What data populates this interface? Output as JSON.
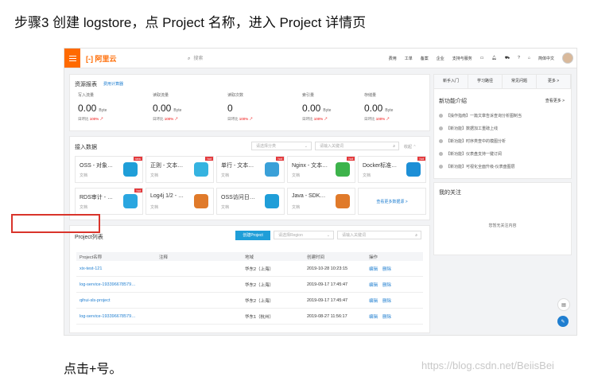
{
  "step_title": "步骤3   创建 logstore，点 Project 名称，进入 Project 详情页",
  "footer_text": "点击+号。",
  "watermark": "https://blog.csdn.net/BeiisBei",
  "topbar": {
    "logo": "[-] 阿里云",
    "search_placeholder": "搜索",
    "nav": [
      "费用",
      "工单",
      "备案",
      "企业",
      "支持与服务"
    ],
    "lang": "简体中文"
  },
  "overview": {
    "title": "资源报表",
    "link": "费用计算器",
    "metrics": [
      {
        "label": "写入流量",
        "value": "0.00",
        "unit": "Byte",
        "cmp_label": "日环比",
        "cmp": "100%"
      },
      {
        "label": "读取流量",
        "value": "0.00",
        "unit": "Byte",
        "cmp_label": "日环比",
        "cmp": "100%"
      },
      {
        "label": "读取次数",
        "value": "0",
        "unit": "",
        "cmp_label": "日环比",
        "cmp": "100%"
      },
      {
        "label": "索引量",
        "value": "0.00",
        "unit": "Byte",
        "cmp_label": "日环比",
        "cmp": "100%"
      },
      {
        "label": "存储量",
        "value": "0.00",
        "unit": "Byte",
        "cmp_label": "日环比",
        "cmp": "100%"
      }
    ]
  },
  "ingest": {
    "title": "接入数据",
    "category_placeholder": "请选择分类",
    "keyword_placeholder": "请输入关键词",
    "collapse": "收起",
    "tiles": [
      {
        "name": "OSS - 对象…",
        "doc": "文档",
        "tag": "new",
        "color": "#1f9ed8"
      },
      {
        "name": "正则 - 文本…",
        "doc": "文档",
        "tag": "hot",
        "color": "#35b3e0"
      },
      {
        "name": "单行 - 文本…",
        "doc": "文档",
        "tag": "hot",
        "color": "#3aa0d8"
      },
      {
        "name": "Nginx - 文本…",
        "doc": "文档",
        "tag": "hot",
        "color": "#3db34b"
      },
      {
        "name": "Docker标准…",
        "doc": "文档",
        "tag": "hot",
        "color": "#1d8fd6"
      },
      {
        "name": "RDS审计 - …",
        "doc": "文档",
        "tag": "hot",
        "color": "#2aa6e0"
      },
      {
        "name": "Log4j 1/2 - …",
        "doc": "文档",
        "tag": "",
        "color": "#e07a2a"
      },
      {
        "name": "OSS访问日…",
        "doc": "文档",
        "tag": "",
        "color": "#1f9ed8"
      },
      {
        "name": "Java - SDK…",
        "doc": "文档",
        "tag": "",
        "color": "#e07a2a"
      }
    ],
    "more": "查看更多数据源 >"
  },
  "projects": {
    "title": "Project列表",
    "create_button": "创建Project",
    "region_placeholder": "请选择Region",
    "keyword_placeholder": "请输入关键词",
    "columns": [
      "Project名称",
      "注释",
      "地域",
      "创建时间",
      "操作"
    ],
    "rows": [
      {
        "name": "xix-test-121",
        "note": "",
        "region": "华东2（上海）",
        "time": "2019-10-28 10:23:15",
        "edit": "编辑",
        "del": "删除"
      },
      {
        "name": "log-service-193396678579…",
        "note": "",
        "region": "华东2（上海）",
        "time": "2019-09-17 17:45:47",
        "edit": "编辑",
        "del": "删除"
      },
      {
        "name": "qihui-sls-project",
        "note": "",
        "region": "华东2（上海）",
        "time": "2019-09-17 17:45:47",
        "edit": "编辑",
        "del": "删除"
      },
      {
        "name": "log-service-193396678579…",
        "note": "",
        "region": "华东1（杭州）",
        "time": "2019-08-27 11:56:17",
        "edit": "编辑",
        "del": "删除"
      }
    ]
  },
  "sidebar": {
    "tabs": [
      "新手入门",
      "学习路径",
      "常见问题",
      "更多 >"
    ],
    "news_title": "新功能介绍",
    "news_more": "查看更多 >",
    "news": [
      "【操作指南】一篇文章告诉查询分析图制当",
      "【新功能】数据加工重磅上线",
      "【新功能】时序类查中的模图分析",
      "【新功能】仪表盘支持一键订阅",
      "【新功能】可视化全面升级-仪表盘图层"
    ],
    "follow_title": "我的关注",
    "follow_empty": "您暂无关注内容"
  }
}
